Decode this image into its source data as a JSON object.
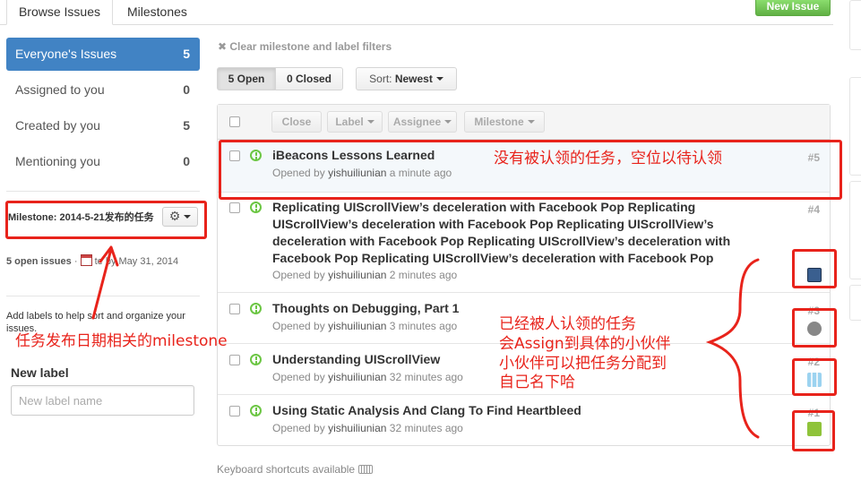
{
  "tabs": {
    "browse": "Browse Issues",
    "milestones": "Milestones",
    "new_issue": "New Issue"
  },
  "sidebar": {
    "filters": [
      {
        "label": "Everyone's Issues",
        "count": "5"
      },
      {
        "label": "Assigned to you",
        "count": "0"
      },
      {
        "label": "Created by you",
        "count": "5"
      },
      {
        "label": "Mentioning you",
        "count": "0"
      }
    ],
    "milestone_label": "Milestone:",
    "milestone_name": "2014-5-21发布的任务",
    "milestone_gear": "⚙",
    "milestone_open": "5 open issues",
    "milestone_due": "te by May 31, 2014",
    "labels_help": "Add labels to help sort and organize your issues.",
    "new_label_title": "New label",
    "new_label_placeholder": "New label name"
  },
  "toolbar": {
    "clear_filters": "✖ Clear milestone and label filters",
    "open_btn": "5 Open",
    "closed_btn": "0 Closed",
    "sort_label": "Sort:",
    "sort_value": "Newest",
    "bulk": {
      "close": "Close",
      "label": "Label",
      "assignee": "Assignee",
      "milestone": "Milestone"
    }
  },
  "issues": [
    {
      "title": "iBeacons Lessons Learned",
      "opened_by": "Opened by",
      "user": "yishuiliunian",
      "time": "a minute ago",
      "number": "#5"
    },
    {
      "title": "Replicating UIScrollView’s deceleration with Facebook Pop Replicating UIScrollView’s deceleration with Facebook Pop Replicating UIScrollView’s deceleration with Facebook Pop Replicating UIScrollView’s deceleration with Facebook Pop Replicating UIScrollView’s deceleration with Facebook Pop",
      "opened_by": "Opened by",
      "user": "yishuiliunian",
      "time": "2 minutes ago",
      "number": "#4"
    },
    {
      "title": "Thoughts on Debugging, Part 1",
      "opened_by": "Opened by",
      "user": "yishuiliunian",
      "time": "3 minutes ago",
      "number": "#3"
    },
    {
      "title": "Understanding UIScrollView",
      "opened_by": "Opened by",
      "user": "yishuiliunian",
      "time": "32 minutes ago",
      "number": "#2"
    },
    {
      "title": "Using Static Analysis And Clang To Find Heartbleed",
      "opened_by": "Opened by",
      "user": "yishuiliunian",
      "time": "32 minutes ago",
      "number": "#1"
    }
  ],
  "footer": {
    "keyboard": "Keyboard shortcuts available"
  },
  "annotations": {
    "unclaimed": "没有被认领的任务，空位以待认领",
    "milestone_note": "任务发布日期相关的milestone",
    "assigned_lines": [
      "已经被人认领的任务",
      "会Assign到具体的小伙伴",
      "小伙伴可以把任务分配到",
      "自己名下哈"
    ]
  },
  "colors": {
    "accent": "#4183c4",
    "open": "#6cc644",
    "annotation": "#e8231b",
    "new_issue": "#60b044"
  },
  "icons": [
    "gear-icon",
    "calendar-icon",
    "issue-opened-icon",
    "keyboard-icon",
    "close-icon",
    "caret-down-icon"
  ]
}
